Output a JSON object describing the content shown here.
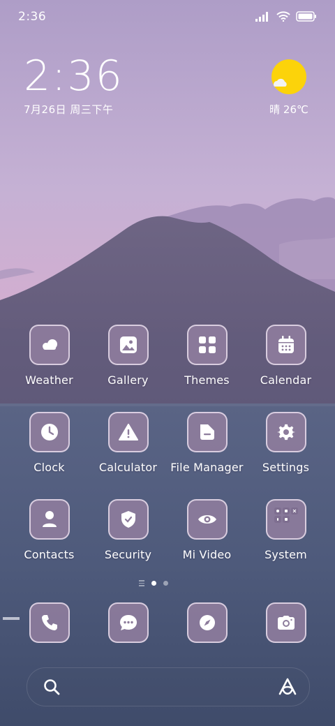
{
  "status_bar": {
    "time": "2:36",
    "icons": [
      "signal-icon",
      "wifi-icon",
      "battery-icon"
    ]
  },
  "clock_widget": {
    "time": "2:36",
    "date": "7月26日 周三下午"
  },
  "weather_widget": {
    "icon": "sunny-cloud-icon",
    "text": "晴 26℃"
  },
  "apps": [
    {
      "label": "Weather",
      "icon": "weather-cloud-icon"
    },
    {
      "label": "Gallery",
      "icon": "gallery-icon"
    },
    {
      "label": "Themes",
      "icon": "themes-icon"
    },
    {
      "label": "Calendar",
      "icon": "calendar-icon"
    },
    {
      "label": "Clock",
      "icon": "clock-icon"
    },
    {
      "label": "Calculator",
      "icon": "calculator-icon"
    },
    {
      "label": "File Manager",
      "icon": "folder-icon"
    },
    {
      "label": "Settings",
      "icon": "gear-icon"
    },
    {
      "label": "Contacts",
      "icon": "contacts-icon"
    },
    {
      "label": "Security",
      "icon": "shield-icon"
    },
    {
      "label": "Mi Video",
      "icon": "video-eye-icon"
    },
    {
      "label": "System",
      "icon": "folder-grid-icon"
    }
  ],
  "dock": [
    {
      "name": "phone",
      "icon": "phone-icon"
    },
    {
      "name": "messages",
      "icon": "message-icon"
    },
    {
      "name": "browser",
      "icon": "compass-icon"
    },
    {
      "name": "camera",
      "icon": "camera-icon"
    }
  ],
  "page_indicator": {
    "pages": 2,
    "active": 1
  },
  "search_bar": {
    "left_icon": "search-icon",
    "right_icon": "assistant-icon"
  },
  "colors": {
    "icon_bg": "#8d7c9c",
    "sun": "#fcd30a",
    "sky_top": "#b6a2c9",
    "water": "#4c5a7a"
  }
}
